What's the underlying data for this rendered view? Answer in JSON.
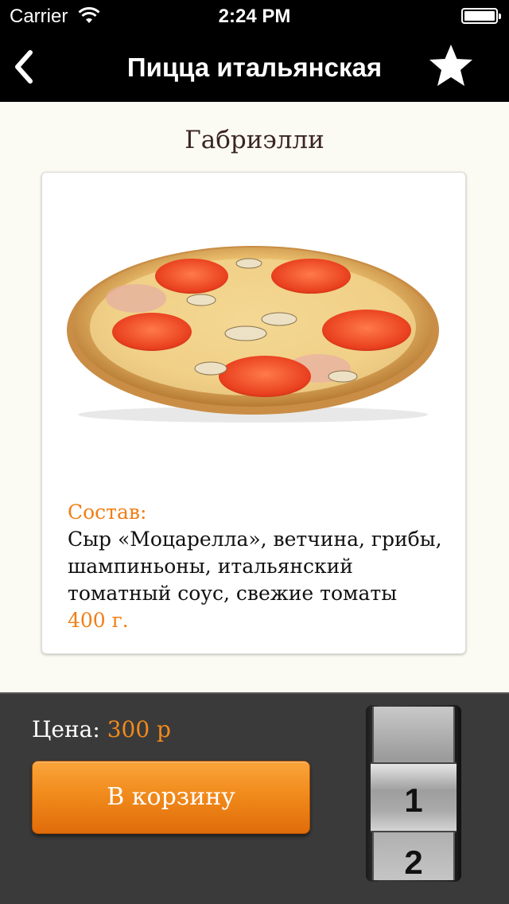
{
  "status_bar": {
    "carrier": "Carrier",
    "time": "2:24 PM",
    "icons": [
      "wifi-icon",
      "battery-icon"
    ]
  },
  "nav": {
    "title": "Пицца итальянская",
    "back_icon": "chevron-left-icon",
    "favorite_icon": "star-icon"
  },
  "item": {
    "name": "Габриэлли",
    "image": "pizza-photo",
    "ingredients_label": "Состав:",
    "ingredients": "Сыр «Моцарелла», ветчина, грибы, шампиньоны, итальянский томатный соус, свежие томаты",
    "weight": "400 г."
  },
  "footer": {
    "price_label": "Цена: ",
    "price_value": "300 р",
    "cart_button": "В корзину",
    "quantity_picker": {
      "selected": "1",
      "next": "2"
    }
  },
  "colors": {
    "accent": "#f07f16",
    "navbar": "#000000",
    "background": "#fcfbf3",
    "footer": "#3a3a3a"
  }
}
